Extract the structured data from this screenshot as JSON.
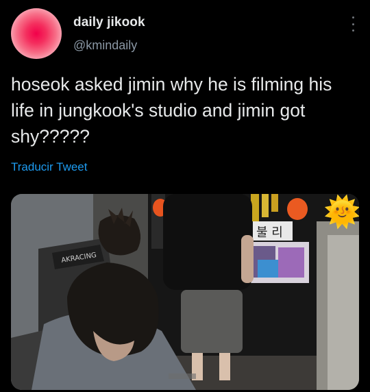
{
  "author": {
    "display_name": "daily jikook",
    "handle": "@kmindaily"
  },
  "tweet": {
    "text": "hoseok asked jimin why he is filming his life in jungkook's studio and jimin got shy?????",
    "translate_label": "Traducir Tweet"
  },
  "media": {
    "chair_brand": "AKRACING",
    "poster_text": "불 리",
    "sticker_emoji": "🌞"
  },
  "icons": {
    "more": "more-options-icon"
  },
  "colors": {
    "background": "#000000",
    "text": "#e7e9ea",
    "secondary": "#8b98a5",
    "link": "#1d9bf0"
  }
}
